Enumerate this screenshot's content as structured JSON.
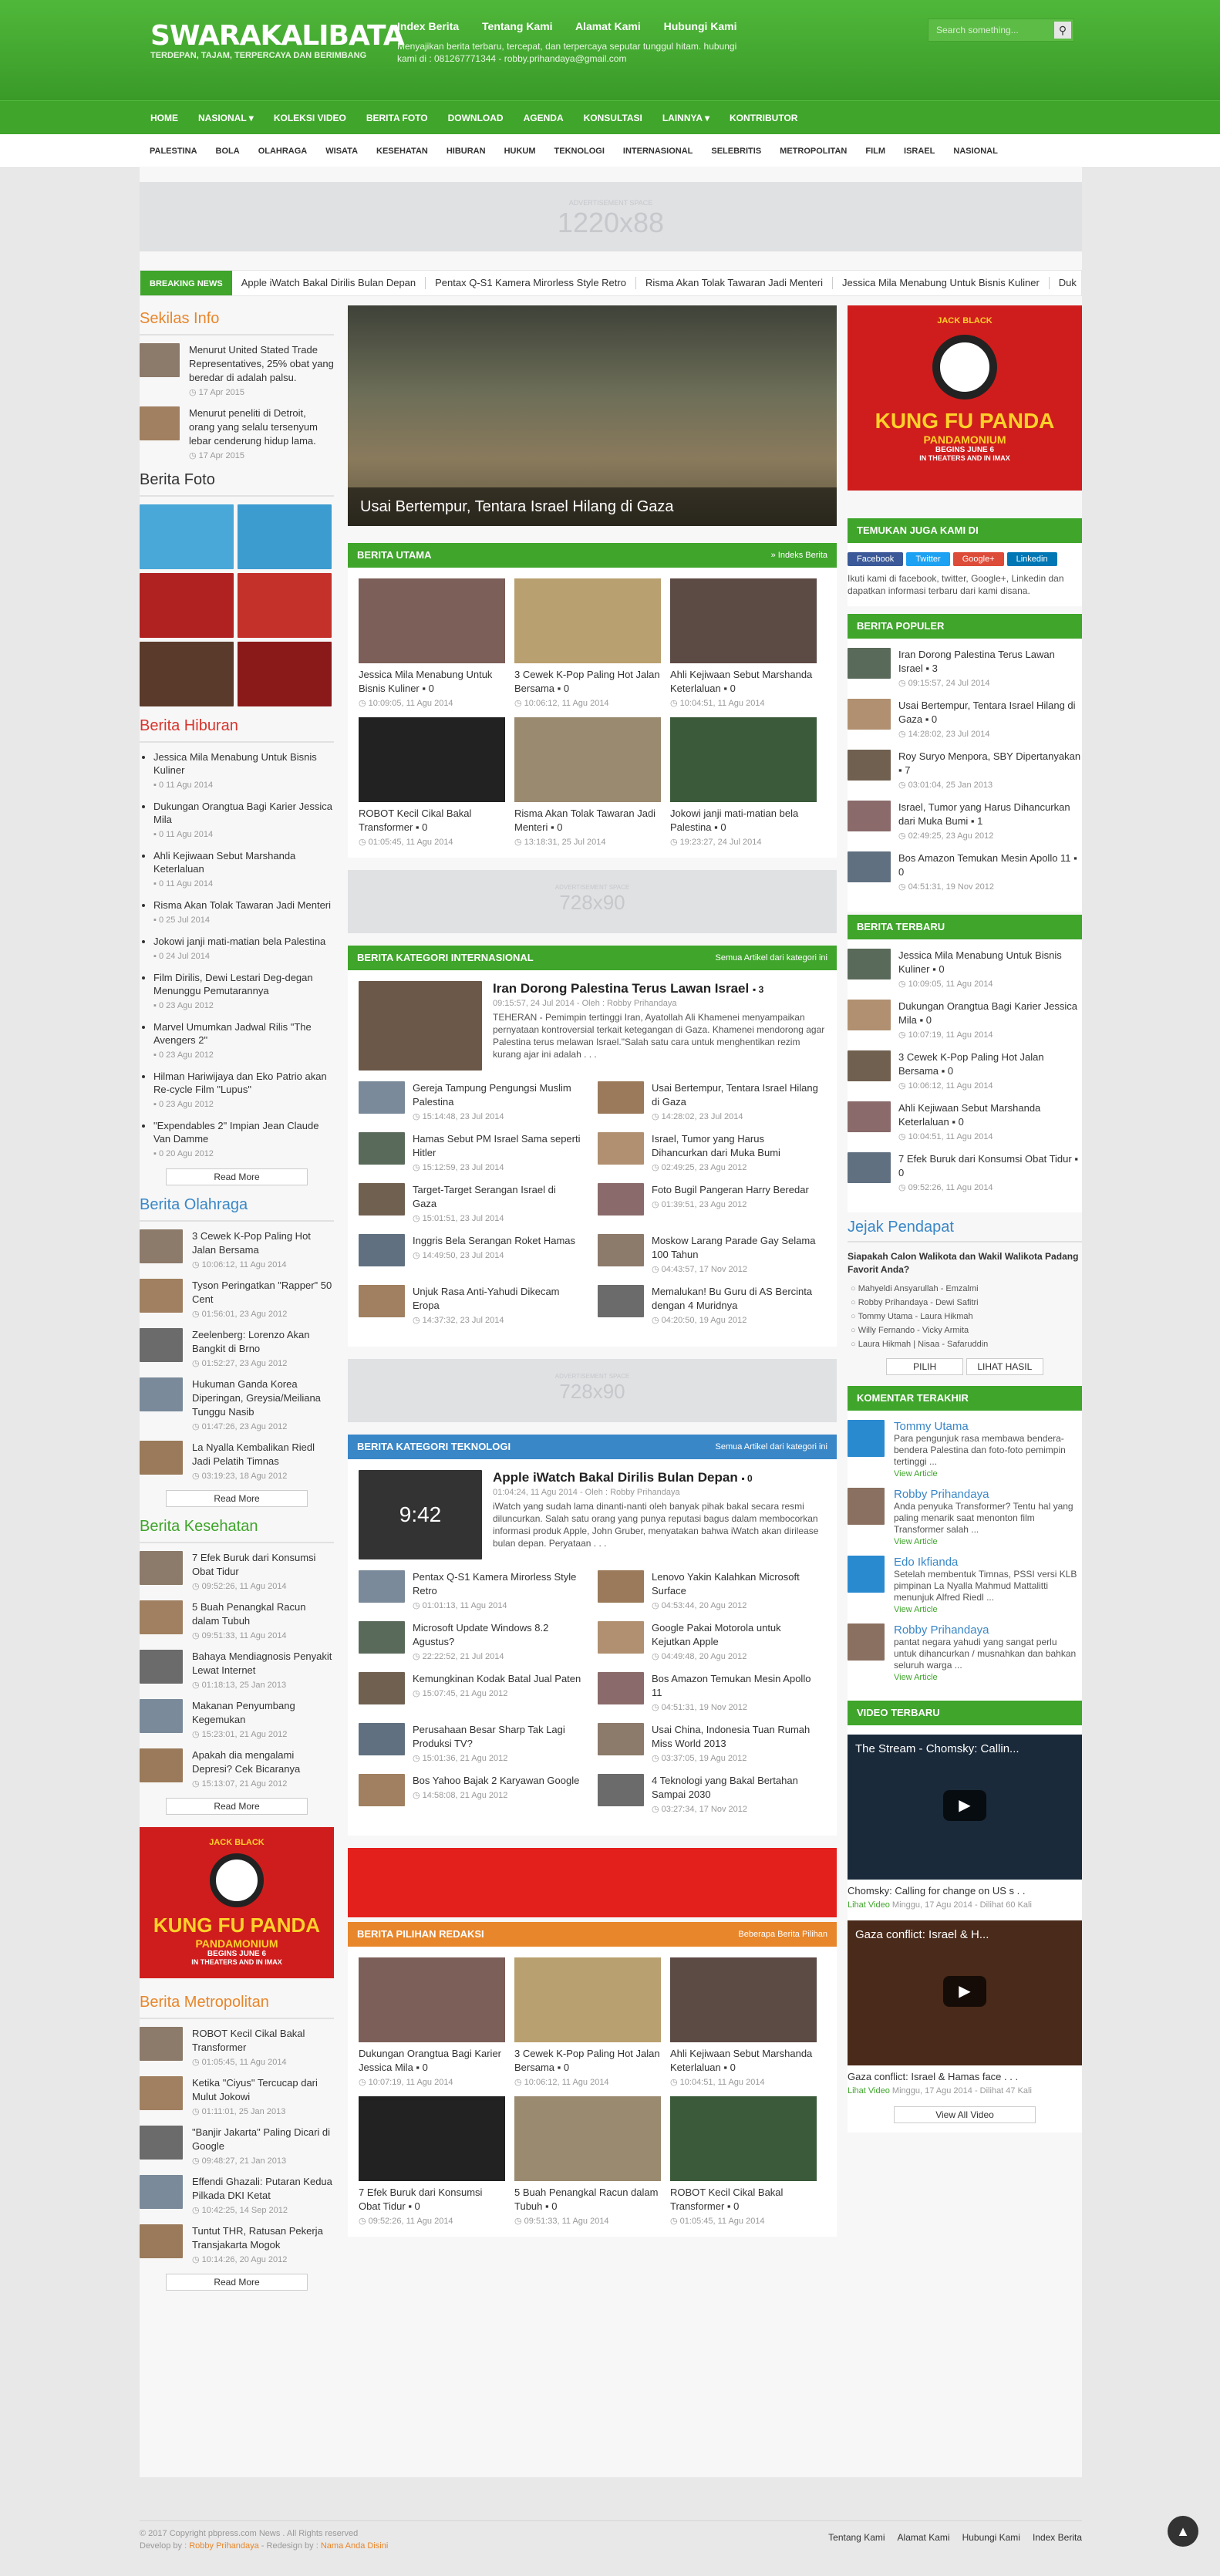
{
  "header": {
    "logo": "SWARAKALIBATA",
    "tagline": "TERDEPAN, TAJAM, TERPERCAYA DAN BERIMBANG",
    "toplinks": [
      "Index Berita",
      "Tentang Kami",
      "Alamat Kami",
      "Hubungi Kami"
    ],
    "desc": "Menyajikan berita terbaru, tercepat, dan terpercaya seputar tunggul hitam. hubungi kami di : 081267771344 - robby.prihandaya@gmail.com",
    "search_placeholder": "Search something..."
  },
  "nav1": [
    "HOME",
    "NASIONAL ▾",
    "KOLEKSI VIDEO",
    "BERITA FOTO",
    "DOWNLOAD",
    "AGENDA",
    "KONSULTASI",
    "LAINNYA ▾",
    "KONTRIBUTOR"
  ],
  "nav2": [
    "PALESTINA",
    "BOLA",
    "OLAHRAGA",
    "WISATA",
    "KESEHATAN",
    "HIBURAN",
    "HUKUM",
    "TEKNOLOGI",
    "INTERNASIONAL",
    "SELEBRITIS",
    "METROPOLITAN",
    "FILM",
    "ISRAEL",
    "NASIONAL"
  ],
  "ad_top": {
    "small": "ADVERTISEMENT SPACE",
    "big": "1220x88"
  },
  "breaking": {
    "label": "BREAKING NEWS",
    "items": [
      "Apple iWatch Bakal Dirilis Bulan Depan",
      "Pentax Q-S1 Kamera Mirorless Style Retro",
      "Risma Akan Tolak Tawaran Jadi Menteri",
      "Jessica Mila Menabung Untuk Bisnis Kuliner",
      "Duk"
    ]
  },
  "sekilas": {
    "title": "Sekilas Info",
    "items": [
      {
        "t": "Menurut United Stated Trade Representatives, 25% obat yang beredar di adalah palsu.",
        "d": "17 Apr 2015"
      },
      {
        "t": "Menurut peneliti di Detroit, orang yang selalu tersenyum lebar cenderung hidup lama.",
        "d": "17 Apr 2015"
      }
    ]
  },
  "foto": {
    "title": "Berita Foto"
  },
  "hiburan": {
    "title": "Berita Hiburan",
    "items": [
      {
        "t": "Jessica Mila Menabung Untuk Bisnis Kuliner",
        "d": "0  11 Agu 2014"
      },
      {
        "t": "Dukungan Orangtua Bagi Karier Jessica Mila",
        "d": "0  11 Agu 2014"
      },
      {
        "t": "Ahli Kejiwaan Sebut Marshanda Keterlaluan",
        "d": "0  11 Agu 2014"
      },
      {
        "t": "Risma Akan Tolak Tawaran Jadi Menteri",
        "d": "0  25 Jul 2014"
      },
      {
        "t": "Jokowi janji mati-matian bela Palestina",
        "d": "0  24 Jul 2014"
      },
      {
        "t": "Film Dirilis, Dewi Lestari Deg-degan Menunggu Pemutarannya",
        "d": "0  23 Agu 2012"
      },
      {
        "t": "Marvel Umumkan Jadwal Rilis \"The Avengers 2\"",
        "d": "0  23 Agu 2012"
      },
      {
        "t": "Hilman Hariwijaya dan Eko Patrio akan Re-cycle Film \"Lupus\"",
        "d": "0  23 Agu 2012"
      },
      {
        "t": "\"Expendables 2\" Impian Jean Claude Van Damme",
        "d": "0  20 Agu 2012"
      }
    ],
    "more": "Read More"
  },
  "olahraga": {
    "title": "Berita Olahraga",
    "items": [
      {
        "t": "3 Cewek K-Pop Paling Hot Jalan Bersama",
        "d": "10:06:12, 11 Agu 2014"
      },
      {
        "t": "Tyson Peringatkan \"Rapper\" 50 Cent",
        "d": "01:56:01, 23 Agu 2012"
      },
      {
        "t": "Zeelenberg: Lorenzo Akan Bangkit di Brno",
        "d": "01:52:27, 23 Agu 2012"
      },
      {
        "t": "Hukuman Ganda Korea Diperingan, Greysia/Meiliana Tunggu Nasib",
        "d": "01:47:26, 23 Agu 2012"
      },
      {
        "t": "La Nyalla Kembalikan Riedl Jadi Pelatih Timnas",
        "d": "03:19:23, 18 Agu 2012"
      }
    ],
    "more": "Read More"
  },
  "kesehatan": {
    "title": "Berita Kesehatan",
    "items": [
      {
        "t": "7 Efek Buruk dari Konsumsi Obat Tidur",
        "d": "09:52:26, 11 Agu 2014"
      },
      {
        "t": "5 Buah Penangkal Racun dalam Tubuh",
        "d": "09:51:33, 11 Agu 2014"
      },
      {
        "t": "Bahaya Mendiagnosis Penyakit Lewat Internet",
        "d": "01:18:13, 25 Jan 2013"
      },
      {
        "t": "Makanan Penyumbang Kegemukan",
        "d": "15:23:01, 21 Agu 2012"
      },
      {
        "t": "Apakah dia mengalami Depresi? Cek Bicaranya",
        "d": "15:13:07, 21 Agu 2012"
      }
    ],
    "more": "Read More"
  },
  "metro": {
    "title": "Berita Metropolitan",
    "items": [
      {
        "t": "ROBOT Kecil Cikal Bakal Transformer",
        "d": "01:05:45, 11 Agu 2014"
      },
      {
        "t": "Ketika \"Ciyus\" Tercucap dari Mulut Jokowi",
        "d": "01:11:01, 25 Jan 2013"
      },
      {
        "t": "\"Banjir Jakarta\" Paling Dicari di Google",
        "d": "09:48:27, 21 Jan 2013"
      },
      {
        "t": "Effendi Ghazali: Putaran Kedua Pilkada DKI Ketat",
        "d": "10:42:25, 14 Sep 2012"
      },
      {
        "t": "Tuntut THR, Ratusan Pekerja Transjakarta Mogok",
        "d": "10:14:26, 20 Agu 2012"
      }
    ],
    "more": "Read More"
  },
  "slider_caption": "Usai Bertempur, Tentara Israel Hilang di Gaza",
  "utama": {
    "title": "BERITA UTAMA",
    "link": "» Indeks Berita",
    "items": [
      {
        "t": "Jessica Mila Menabung Untuk Bisnis Kuliner",
        "d": "10:09:05, 11 Agu 2014"
      },
      {
        "t": "3 Cewek K-Pop Paling Hot Jalan Bersama",
        "d": "10:06:12, 11 Agu 2014"
      },
      {
        "t": "Ahli Kejiwaan Sebut Marshanda Keterlaluan",
        "d": "10:04:51, 11 Agu 2014"
      },
      {
        "t": "ROBOT Kecil Cikal Bakal Transformer",
        "d": "01:05:45, 11 Agu 2014"
      },
      {
        "t": "Risma Akan Tolak Tawaran Jadi Menteri",
        "d": "13:18:31, 25 Jul 2014"
      },
      {
        "t": "Jokowi janji mati-matian bela Palestina",
        "d": "19:23:27, 24 Jul 2014"
      }
    ]
  },
  "ad_mid": {
    "small": "ADVERTISEMENT SPACE",
    "big": "728x90"
  },
  "intl": {
    "title": "BERITA KATEGORI INTERNASIONAL",
    "link": "Semua Artikel dari kategori ini",
    "lead": {
      "t": "Iran Dorong Palestina Terus Lawan Israel",
      "c": "3",
      "m": "09:15:57, 24 Jul 2014 - Oleh : Robby Prihandaya",
      "x": "TEHERAN - Pemimpin tertinggi Iran, Ayatollah Ali Khamenei menyampaikan pernyataan kontroversial terkait ketegangan di Gaza. Khamenei mendorong agar Palestina terus melawan Israel.\"Salah satu cara untuk menghentikan rezim kurang ajar ini adalah . . ."
    },
    "items": [
      {
        "t": "Gereja Tampung Pengungsi Muslim Palestina",
        "d": "15:14:48, 23 Jul 2014"
      },
      {
        "t": "Usai Bertempur, Tentara Israel Hilang di Gaza",
        "d": "14:28:02, 23 Jul 2014"
      },
      {
        "t": "Hamas Sebut PM Israel Sama seperti Hitler",
        "d": "15:12:59, 23 Jul 2014"
      },
      {
        "t": "Israel, Tumor yang Harus Dihancurkan dari Muka Bumi",
        "d": "02:49:25, 23 Agu 2012"
      },
      {
        "t": "Target-Target Serangan Israel di Gaza",
        "d": "15:01:51, 23 Jul 2014"
      },
      {
        "t": "Foto Bugil Pangeran Harry Beredar",
        "d": "01:39:51, 23 Agu 2012"
      },
      {
        "t": "Inggris Bela Serangan Roket Hamas",
        "d": "14:49:50, 23 Jul 2014"
      },
      {
        "t": "Moskow Larang Parade Gay Selama 100 Tahun",
        "d": "04:43:57, 17 Nov 2012"
      },
      {
        "t": "Unjuk Rasa Anti-Yahudi Dikecam Eropa",
        "d": "14:37:32, 23 Jul 2014"
      },
      {
        "t": "Memalukan! Bu Guru di AS Bercinta dengan 4 Muridnya",
        "d": "04:20:50, 19 Agu 2012"
      }
    ]
  },
  "tekno": {
    "title": "BERITA KATEGORI TEKNOLOGI",
    "link": "Semua Artikel dari kategori ini",
    "lead": {
      "t": "Apple iWatch Bakal Dirilis Bulan Depan",
      "c": "0",
      "m": "01:04:24, 11 Agu 2014 - Oleh : Robby Prihandaya",
      "x": "iWatch yang sudah lama dinanti-nanti oleh banyak pihak bakal secara resmi diluncurkan. Salah satu orang yang punya reputasi bagus dalam membocorkan informasi produk Apple, John Gruber, menyatakan bahwa iWatch akan dirilease bulan depan. Peryataan . . ."
    },
    "items": [
      {
        "t": "Pentax Q-S1 Kamera Mirorless Style Retro",
        "d": "01:01:13, 11 Agu 2014"
      },
      {
        "t": "Lenovo Yakin Kalahkan Microsoft Surface",
        "d": "04:53:44, 20 Agu 2012"
      },
      {
        "t": "Microsoft Update Windows 8.2 Agustus?",
        "d": "22:22:52, 21 Jul 2014"
      },
      {
        "t": "Google Pakai Motorola untuk Kejutkan Apple",
        "d": "04:49:48, 20 Agu 2012"
      },
      {
        "t": "Kemungkinan Kodak Batal Jual Paten",
        "d": "15:07:45, 21 Agu 2012"
      },
      {
        "t": "Bos Amazon Temukan Mesin Apollo 11",
        "d": "04:51:31, 19 Nov 2012"
      },
      {
        "t": "Perusahaan Besar Sharp Tak Lagi Produksi TV?",
        "d": "15:01:36, 21 Agu 2012"
      },
      {
        "t": "Usai China, Indonesia Tuan Rumah Miss World 2013",
        "d": "03:37:05, 19 Agu 2012"
      },
      {
        "t": "Bos Yahoo Bajak 2 Karyawan Google",
        "d": "14:58:08, 21 Agu 2012"
      },
      {
        "t": "4 Teknologi yang Bakal Bertahan Sampai 2030",
        "d": "03:27:34, 17 Nov 2012"
      }
    ]
  },
  "redaksi": {
    "title": "BERITA PILIHAN REDAKSI",
    "link": "Beberapa Berita Pilihan",
    "items": [
      {
        "t": "Dukungan Orangtua Bagi Karier Jessica Mila",
        "d": "10:07:19, 11 Agu 2014"
      },
      {
        "t": "3 Cewek K-Pop Paling Hot Jalan Bersama",
        "d": "10:06:12, 11 Agu 2014"
      },
      {
        "t": "Ahli Kejiwaan Sebut Marshanda Keterlaluan",
        "d": "10:04:51, 11 Agu 2014"
      },
      {
        "t": "7 Efek Buruk dari Konsumsi Obat Tidur",
        "d": "09:52:26, 11 Agu 2014"
      },
      {
        "t": "5 Buah Penangkal Racun dalam Tubuh",
        "d": "09:51:33, 11 Agu 2014"
      },
      {
        "t": "ROBOT Kecil Cikal Bakal Transformer",
        "d": "01:05:45, 11 Agu 2014"
      }
    ]
  },
  "poster": {
    "top": "JACK BLACK",
    "title": "KUNG FU PANDA",
    "sub": "PANDAMONIUM",
    "sub2": "BEGINS JUNE 6",
    "sub3": "IN THEATERS AND IN IMAX"
  },
  "temukan": {
    "title": "TEMUKAN JUGA KAMI DI",
    "buttons": [
      "Facebook",
      "Twitter",
      "Google+",
      "Linkedin"
    ],
    "text": "Ikuti kami di facebook, twitter, Google+, Linkedin dan dapatkan informasi terbaru dari kami disana."
  },
  "populer": {
    "title": "BERITA POPULER",
    "items": [
      {
        "t": "Iran Dorong Palestina Terus Lawan Israel",
        "c": "3",
        "d": "09:15:57, 24 Jul 2014"
      },
      {
        "t": "Usai Bertempur, Tentara Israel Hilang di Gaza",
        "c": "0",
        "d": "14:28:02, 23 Jul 2014"
      },
      {
        "t": "Roy Suryo Menpora, SBY Dipertanyakan",
        "c": "7",
        "d": "03:01:04, 25 Jan 2013"
      },
      {
        "t": "Israel, Tumor yang Harus Dihancurkan dari Muka Bumi",
        "c": "1",
        "d": "02:49:25, 23 Agu 2012"
      },
      {
        "t": "Bos Amazon Temukan Mesin Apollo 11",
        "c": "0",
        "d": "04:51:31, 19 Nov 2012"
      }
    ]
  },
  "terbaru": {
    "title": "BERITA TERBARU",
    "items": [
      {
        "t": "Jessica Mila Menabung Untuk Bisnis Kuliner",
        "c": "0",
        "d": "10:09:05, 11 Agu 2014"
      },
      {
        "t": "Dukungan Orangtua Bagi Karier Jessica Mila",
        "c": "0",
        "d": "10:07:19, 11 Agu 2014"
      },
      {
        "t": "3 Cewek K-Pop Paling Hot Jalan Bersama",
        "c": "0",
        "d": "10:06:12, 11 Agu 2014"
      },
      {
        "t": "Ahli Kejiwaan Sebut Marshanda Keterlaluan",
        "c": "0",
        "d": "10:04:51, 11 Agu 2014"
      },
      {
        "t": "7 Efek Buruk dari Konsumsi Obat Tidur",
        "c": "0",
        "d": "09:52:26, 11 Agu 2014"
      }
    ]
  },
  "jejak": {
    "title": "Jejak Pendapat",
    "q": "Siapakah Calon Walikota dan Wakil Walikota Padang Favorit Anda?",
    "opts": [
      "Mahyeldi Ansyarullah - Emzalmi",
      "Robby Prihandaya - Dewi Safitri",
      "Tommy Utama - Laura Hikmah",
      "Willy Fernando - Vicky Armita",
      "Laura Hikmah | Nisaa - Safaruddin"
    ],
    "pilih": "PILIH",
    "hasil": "LIHAT HASIL"
  },
  "komentar": {
    "title": "KOMENTAR TERAKHIR",
    "items": [
      {
        "n": "Tommy Utama",
        "t": "Para pengunjuk rasa membawa bendera-bendera Palestina dan foto-foto pemimpin tertinggi ..."
      },
      {
        "n": "Robby Prihandaya",
        "t": "Anda penyuka Transformer? Tentu hal yang paling menarik saat menonton film Transformer salah ..."
      },
      {
        "n": "Edo Ikfianda",
        "t": "Setelah membentuk Timnas, PSSI versi KLB pimpinan La Nyalla Mahmud Mattalitti menunjuk Alfred Riedl ..."
      },
      {
        "n": "Robby Prihandaya",
        "t": "pantat negara yahudi yang sangat perlu untuk dihancurkan / musnahkan dan bahkan seluruh warga ..."
      }
    ],
    "view": "View Article"
  },
  "video": {
    "title": "VIDEO TERBARU",
    "items": [
      {
        "yt": "The Stream - Chomsky: Callin...",
        "t": "Chomsky: Calling for change on US s . .",
        "l": "Lihat Video",
        "m": "Minggu, 17 Agu 2014 - Dilihat 60 Kali"
      },
      {
        "yt": "Gaza conflict: Israel & H...",
        "t": "Gaza conflict: Israel & Hamas face . . .",
        "l": "Lihat Video",
        "m": "Minggu, 17 Agu 2014 - Dilihat 47 Kali"
      }
    ],
    "all": "View All Video"
  },
  "footer": {
    "copy": "© 2017 Copyright pbpress.com News . All Rights reserved",
    "dev": "Develop by :",
    "devname": "Robby Prihandaya",
    "redesign": " - Redesign by :",
    "redname": "Nama Anda Disini",
    "links": [
      "Tentang Kami",
      "Alamat Kami",
      "Hubungi Kami",
      "Index Berita"
    ]
  }
}
